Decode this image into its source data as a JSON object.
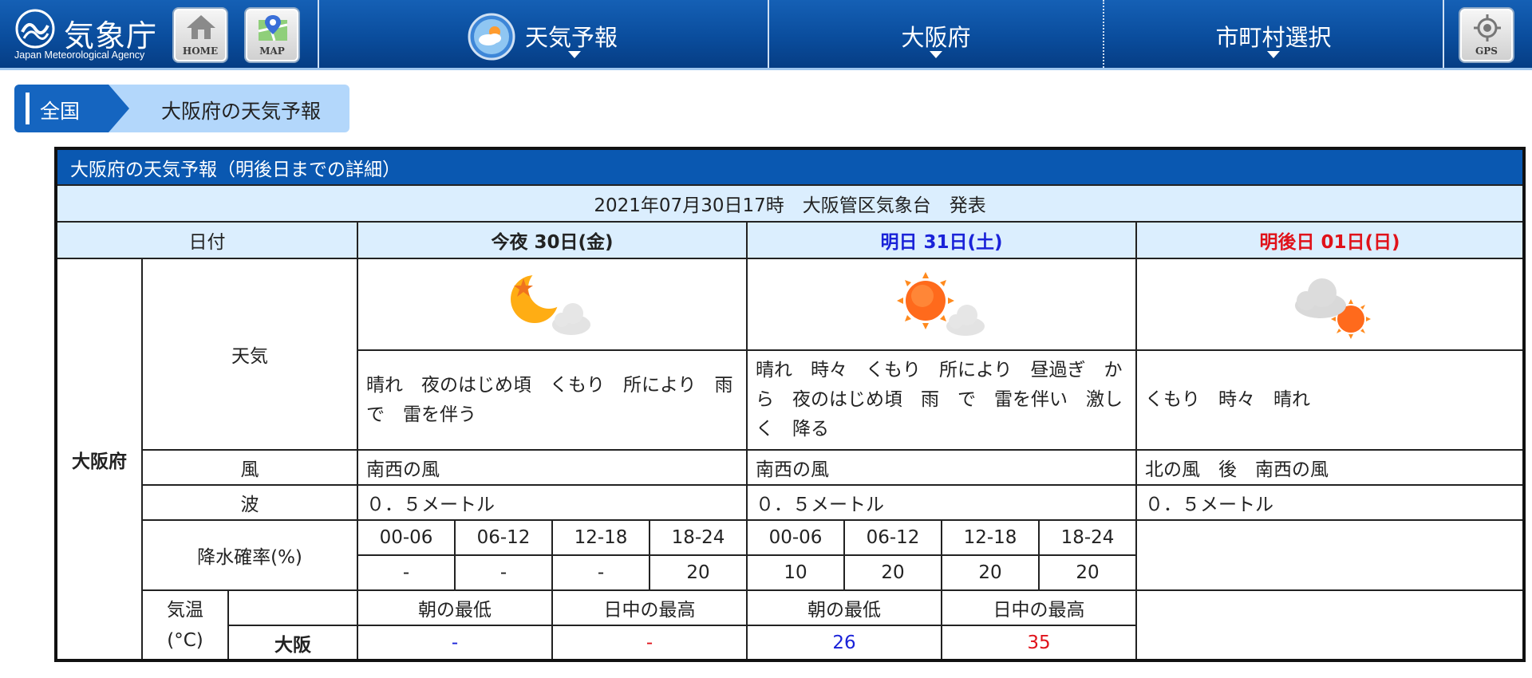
{
  "header": {
    "logo_title": "気象庁",
    "logo_subtitle": "Japan Meteorological Agency",
    "home_label": "HOME",
    "map_label": "MAP",
    "gps_label": "GPS",
    "nav": [
      {
        "label": "天気予報"
      },
      {
        "label": "大阪府"
      },
      {
        "label": "市町村選択"
      }
    ]
  },
  "breadcrumb": {
    "root": "全国",
    "current": "大阪府の天気予報"
  },
  "forecast": {
    "title": "大阪府の天気予報（明後日までの詳細）",
    "issued": "2021年07月30日17時　大阪管区気象台　発表",
    "date_header": "日付",
    "region": "大阪府",
    "days": [
      {
        "label": "今夜 30日(金)",
        "weather": "晴れ　夜のはじめ頃　くもり　所により　雨　で　雷を伴う",
        "wind": "南西の風",
        "wave": "０．５メートル"
      },
      {
        "label": "明日 31日(土)",
        "weather": "晴れ　時々　くもり　所により　昼過ぎ　から　夜のはじめ頃　雨　で　雷を伴い　激しく　降る",
        "wind": "南西の風",
        "wave": "０．５メートル"
      },
      {
        "label": "明後日 01日(日)",
        "weather": "くもり　時々　晴れ",
        "wind": "北の風　後　南西の風",
        "wave": "０．５メートル"
      }
    ],
    "row_labels": {
      "weather": "天気",
      "wind": "風",
      "wave": "波",
      "pop": "降水確率(%)",
      "temp_line1": "気温",
      "temp_line2": "(°C)"
    },
    "pop": {
      "periods": [
        "00-06",
        "06-12",
        "12-18",
        "18-24",
        "00-06",
        "06-12",
        "12-18",
        "18-24"
      ],
      "values": [
        "-",
        "-",
        "-",
        "20",
        "10",
        "20",
        "20",
        "20"
      ]
    },
    "temp": {
      "headers": [
        "朝の最低",
        "日中の最高",
        "朝の最低",
        "日中の最高"
      ],
      "city": "大阪",
      "values": [
        "-",
        "-",
        "26",
        "35"
      ]
    }
  },
  "colors": {
    "header_blue": "#0a4d9d",
    "title_blue": "#0a58b1",
    "light_blue": "#dbeefe",
    "tomorrow_blue": "#1a22d8",
    "holiday_red": "#e0121a"
  },
  "icons": [
    "home-icon",
    "map-pin-icon",
    "gps-target-icon",
    "weather-forecast-icon",
    "moon-cloud-icon",
    "sun-cloud-icon",
    "cloud-sun-icon"
  ]
}
